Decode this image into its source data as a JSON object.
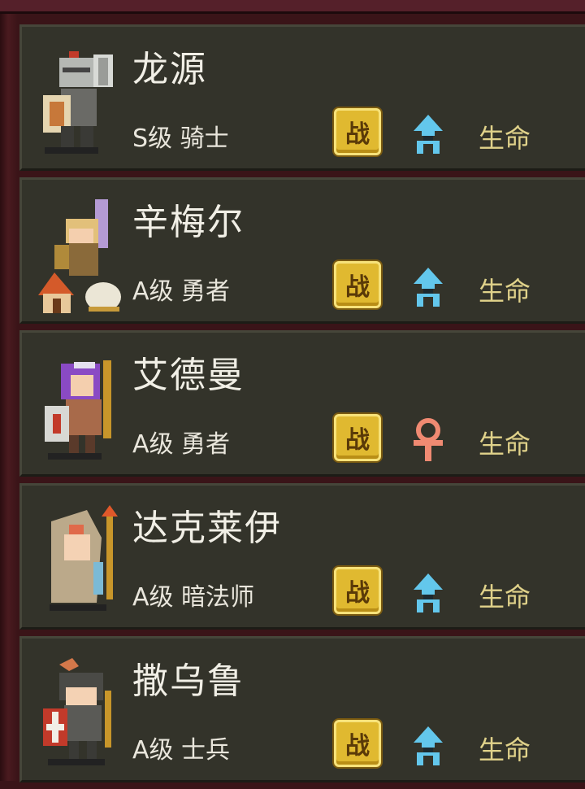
{
  "heroes": [
    {
      "name": "龙源",
      "rank": "S级 骑士",
      "battle_label": "战",
      "element_icon": "blue-arrow-icon",
      "stat": "生命"
    },
    {
      "name": "辛梅尔",
      "rank": "A级 勇者",
      "battle_label": "战",
      "element_icon": "blue-arrow-icon",
      "stat": "生命"
    },
    {
      "name": "艾德曼",
      "rank": "A级 勇者",
      "battle_label": "战",
      "element_icon": "red-ankh-icon",
      "stat": "生命"
    },
    {
      "name": "达克莱伊",
      "rank": "A级 暗法师",
      "battle_label": "战",
      "element_icon": "blue-arrow-icon",
      "stat": "生命"
    },
    {
      "name": "撒乌鲁",
      "rank": "A级 士兵",
      "battle_label": "战",
      "element_icon": "blue-arrow-icon",
      "stat": "生命"
    }
  ],
  "colors": {
    "card_bg": "#33332a",
    "frame": "#3a1418",
    "battle_gold": "#e0b930",
    "blue_icon": "#63c7ec",
    "red_icon": "#f08a72",
    "stat_text": "#e0d28a"
  }
}
